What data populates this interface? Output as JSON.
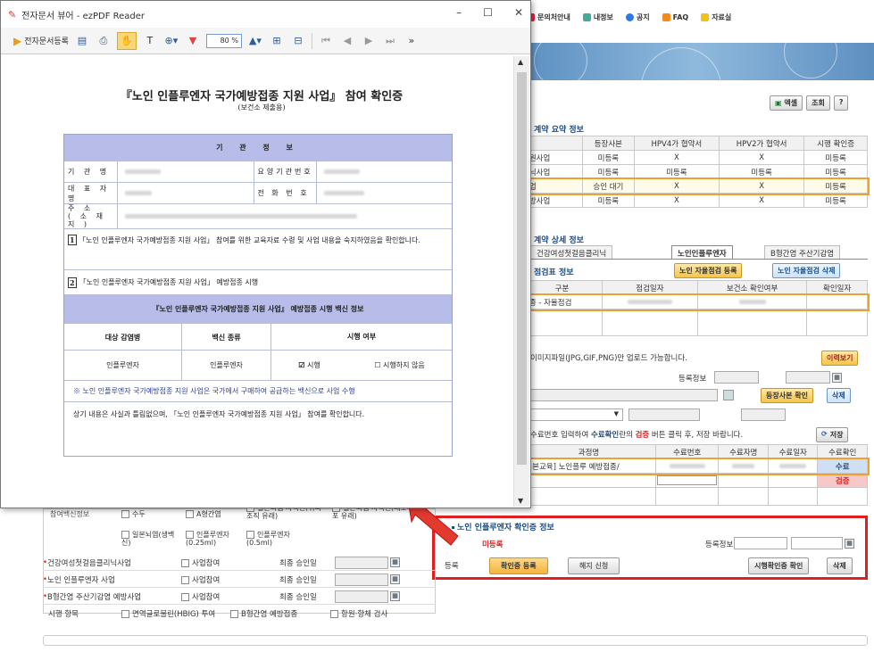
{
  "pdf_window": {
    "title": "전자문서 뷰어 - ezPDF Reader",
    "toolbar": {
      "register_label": "전자문서등록",
      "zoom": "80 %"
    },
    "document": {
      "title": "『노인 인플루엔자 국가예방접종 지원 사업』 참여 확인증",
      "subtitle": "(보건소 제출용)",
      "org_header": "기 관 정 보",
      "fields": {
        "name": "기 관 명",
        "code": "요양기관번호",
        "rep": "대 표 자 명",
        "phone": "전 화 번 호",
        "addr": "주 소\n( 소 재 지 )"
      },
      "item1": "「노인 인플루엔자 국가예방접종 지원 사업」 참여를 위한 교육자료 수령 및 사업 내용을 숙지하였음을 확인합니다.",
      "item1_num": "1",
      "item2": "「노인 인플루엔자 국가예방접종 지원 사업」 예방접종 시행",
      "item2_num": "2",
      "vaccine_header": "『노인 인플루엔자 국가예방접종 지원 사업』 예방접종 시행 백신 정보",
      "col_disease": "대상 감염병",
      "col_vaccine": "백신 종류",
      "col_status": "시행 여부",
      "row_disease": "인플루엔자",
      "row_vaccine": "인플루엔자",
      "opt_yes": "시행",
      "opt_no": "시행하지 않음",
      "note": "※ 노인 인플루엔자 국가예방접종 지원 사업은 국가에서 구매하여 공급하는 백신으로 사업 수행",
      "confirm": "상기 내용은 사실과 틀림없으며, 「노인 인플루엔자 국가예방접종 지원 사업」 참여를 확인합니다."
    }
  },
  "top_nav": [
    "문의처안내",
    "내정보",
    "공지",
    "FAQ",
    "자료실"
  ],
  "buttons": {
    "excel": "엑셀",
    "search": "조회",
    "help": "?"
  },
  "summary": {
    "title": "계약 요약 정보",
    "headers": [
      "",
      "등장사본",
      "HPV4가 협약서",
      "HPV2가 협약서",
      "시행 확인증"
    ],
    "rows": [
      [
        "지원사업",
        "미등록",
        "X",
        "X",
        "미등록"
      ],
      [
        "리닉사업",
        "미등록",
        "미등록",
        "미등록",
        "미등록"
      ],
      [
        "사업",
        "승인 대기",
        "X",
        "X",
        "미등록"
      ],
      [
        "예방사업",
        "미등록",
        "X",
        "X",
        "미등록"
      ]
    ]
  },
  "detail": {
    "title": "계약 상세 정보",
    "tabs": [
      "건강여성첫걸음클리닉",
      "노인인플루엔자",
      "B형간염 주산기감염"
    ],
    "check_title": "점검표 정보",
    "check_register": "노인 자율점검 등록",
    "check_delete": "노인 자율점검 삭제",
    "check_headers": [
      "구분",
      "점검일자",
      "보건소 확인여부",
      "확인일자"
    ],
    "check_row": "접종 - 자율점검",
    "upload_note": "이미지파일(JPG,GIF,PNG)만 업로드 가능합니다.",
    "history_btn": "이력보기",
    "reg_info": "등록정보",
    "copy_confirm": "등장사본 확인",
    "delete": "삭제",
    "cert_note_pre": "수료번호 입력하여 ",
    "cert_note_bold": "수료확인",
    "cert_note_mid": "란의 ",
    "cert_note_red": "검증",
    "cert_note_post": " 버튼 클릭 후, 저장 바랍니다.",
    "save": "저장",
    "course_headers": [
      "과정명",
      "수료번호",
      "수료자명",
      "수료일자",
      "수료확인"
    ],
    "course_row": "[기본교육] 노인플루 예방접종/",
    "confirm_btn": "수료",
    "verify_btn": "검증"
  },
  "flu_cert": {
    "title": "노인 인플루엔자 확인증 정보",
    "status": "미등록",
    "reg_info": "등록정보",
    "row_label": "등록",
    "register_btn": "확인증 등록",
    "cancel_btn": "해지 신청",
    "view_btn": "시행확인증 확인",
    "delete_btn": "삭제"
  },
  "left_panel": {
    "opts_label": "참여백신정보",
    "opts": [
      "수두",
      "A형간염",
      "일본뇌염 사백신(쥐뇌조직 유래)",
      "일본뇌염 사백신(베로세포 유래)",
      "일본뇌염(생백신)",
      "인플루엔자(0.25ml)",
      "인플루엔자(0.5ml)"
    ],
    "rows": [
      {
        "label": "건강여성첫걸음클리닉사업",
        "opt": "사업참여",
        "date_label": "최종 승인일"
      },
      {
        "label": "노인 인플루엔자 사업",
        "opt": "사업참여",
        "date_label": "최종 승인일"
      },
      {
        "label": "B형간염 주산기감염 예방사업",
        "opt": "사업참여",
        "date_label": "최종 승인일"
      }
    ],
    "last_label": "시행 항목",
    "last_opts": [
      "면역글로불린(HBIG) 투여",
      "B형간염 예방접종",
      "항원·항체 검사"
    ]
  }
}
